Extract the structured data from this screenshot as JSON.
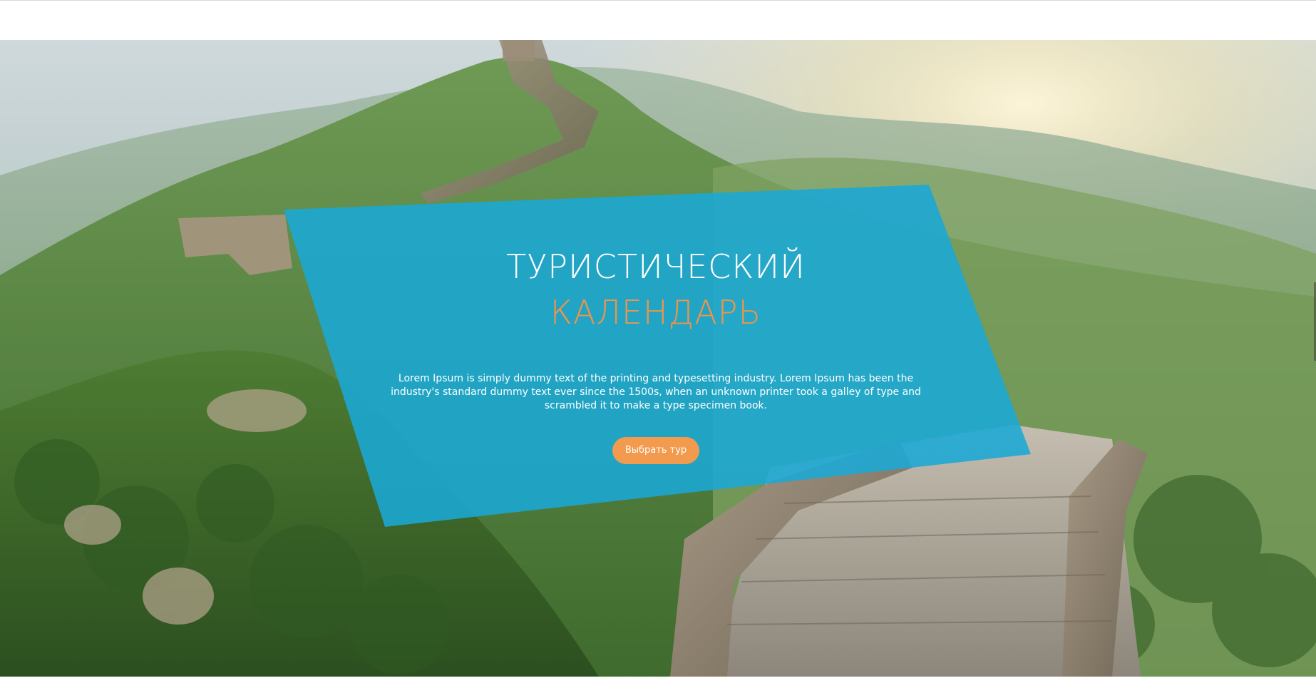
{
  "hero": {
    "title_line1": "ТУРИСТИЧЕСКИЙ",
    "title_line2": "КАЛЕНДАРЬ",
    "description": "Lorem Ipsum is simply dummy text of the printing and typesetting industry. Lorem Ipsum has been the industry's standard dummy text ever since the 1500s, when an unknown printer took a galley of type and scrambled it to make a type specimen book.",
    "button_label": "Выбрать тур"
  },
  "colors": {
    "panel": "#1aa9d6",
    "accent": "#f29a4d",
    "title": "#ffffff"
  }
}
